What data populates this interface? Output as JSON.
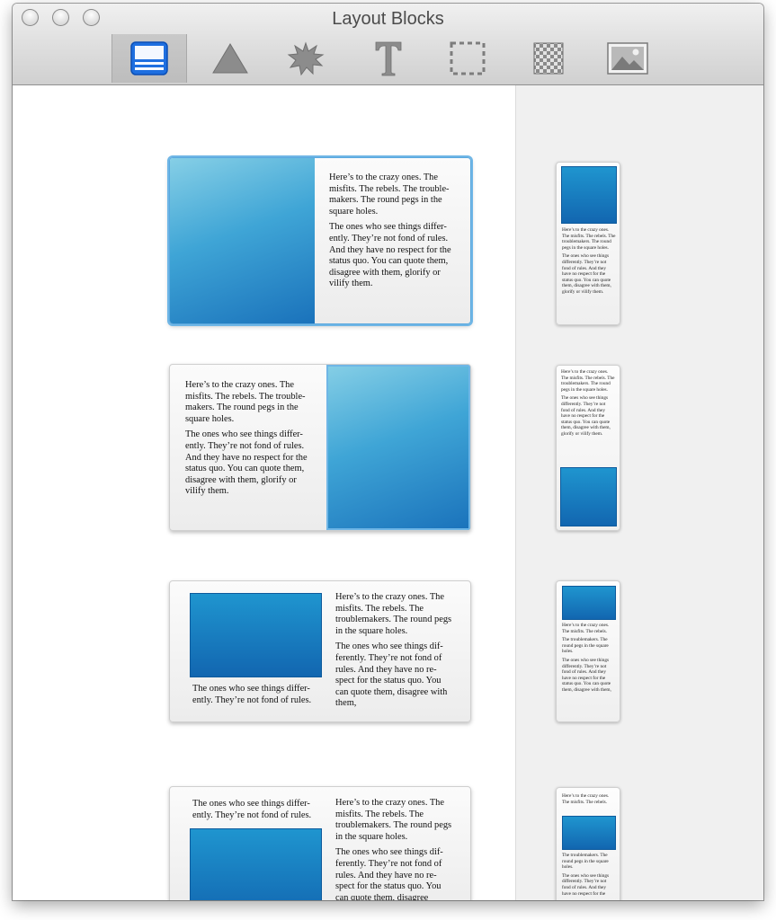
{
  "window": {
    "title": "Layout Blocks"
  },
  "toolbar": {
    "tools": [
      {
        "name": "layout-blocks-icon",
        "selected": true
      },
      {
        "name": "triangle-shape-icon",
        "selected": false
      },
      {
        "name": "starburst-shape-icon",
        "selected": false
      },
      {
        "name": "text-icon",
        "selected": false
      },
      {
        "name": "dashed-frame-icon",
        "selected": false
      },
      {
        "name": "pattern-fill-icon",
        "selected": false
      },
      {
        "name": "picture-icon",
        "selected": false
      }
    ]
  },
  "texts": {
    "p1": "Here’s to the crazy ones. The misfits. The rebels. The trouble-makers. The round pegs in the square holes.",
    "p2": "The ones who see things differ-ently. They’re not fond of rules. And they have no respect for the status quo. You can quote them, disagree with them, glorify or vilify them.",
    "c3_caption": "The ones who see things differ-ently. They’re not fond of rules.",
    "c3_right1": "Here’s to the crazy ones. The misfits. The rebels. The troublemakers. The round pegs in the square holes.",
    "c3_right2": "The ones who see things dif-ferently. They’re not fond of rules. And they have no re-spect for the status quo. You can quote them, disagree with them,",
    "c4_top": "The ones who see things differ-ently. They’re not fond of rules.",
    "c4_right2": "The ones who see things dif-ferently. They’re not fond of rules. And they have no re-spect for the status quo. You can quote them, disagree",
    "m1_p1": "Here’s to the crazy ones. The misfits. The rebels. The troublemakers. The round pegs in the square holes.",
    "m1_p2": "The ones who see things differently. They’re not fond of rules. And they have no respect for the status quo. You can quote them, disagree with them, glorify or vilify them.",
    "m3_p1": "Here’s to the crazy ones. The misfits. The rebels.",
    "m3_p2": "The troublemakers. The round pegs in the square holes.",
    "m3_p3": "The ones who see things differently. They’re not fond of rules. And they have no respect for the status quo. You can quote them, disagree with them,",
    "m4_p2": "The troublemakers. The round pegs in the square holes.",
    "m4_p3": "The ones who see things differently. They’re not fond of rules. And they have no respect for the"
  }
}
